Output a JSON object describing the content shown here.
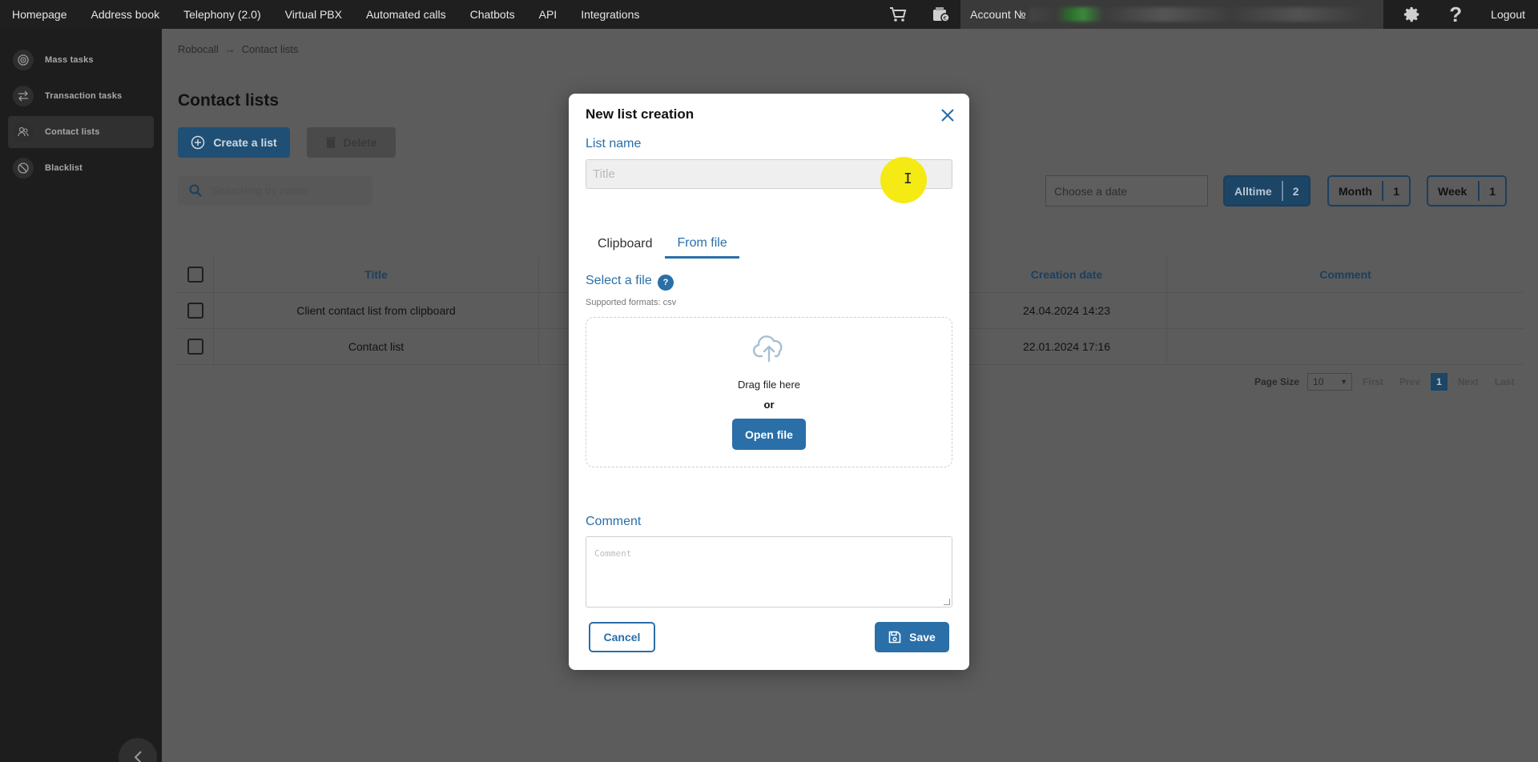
{
  "topnav": {
    "links": [
      "Homepage",
      "Address book",
      "Telephony (2.0)",
      "Virtual PBX",
      "Automated calls",
      "Chatbots",
      "API",
      "Integrations"
    ],
    "account_label": "Account №",
    "logout": "Logout",
    "icons": [
      "cart-icon",
      "wallet-icon",
      "gear-icon",
      "help-icon"
    ]
  },
  "sidebar": {
    "items": [
      {
        "label": "Mass tasks",
        "icon": "target-icon"
      },
      {
        "label": "Transaction tasks",
        "icon": "arrows-icon"
      },
      {
        "label": "Contact lists",
        "icon": "people-icon"
      },
      {
        "label": "Blacklist",
        "icon": "block-icon"
      }
    ],
    "active_index": 2
  },
  "breadcrumb": {
    "root": "Robocall",
    "current": "Contact lists"
  },
  "page": {
    "title": "Contact lists",
    "create_label": "Create a list",
    "delete_label": "Delete",
    "search_placeholder": "Searching by name",
    "date_placeholder": "Choose a date",
    "periods": [
      {
        "label": "Alltime",
        "count": "2"
      },
      {
        "label": "Month",
        "count": "1"
      },
      {
        "label": "Week",
        "count": "1"
      }
    ]
  },
  "table": {
    "headers": {
      "title": "Title",
      "creation_date": "Creation date",
      "comment": "Comment"
    },
    "rows": [
      {
        "title": "Client contact list from clipboard",
        "date": "24.04.2024 14:23",
        "comment": ""
      },
      {
        "title": "Contact list",
        "date": "22.01.2024 17:16",
        "comment": ""
      }
    ]
  },
  "pager": {
    "page_size_label": "Page Size",
    "page_size": "10",
    "first": "First",
    "prev": "Prev",
    "current": "1",
    "next": "Next",
    "last": "Last"
  },
  "modal": {
    "title": "New list creation",
    "list_name_label": "List name",
    "list_name_placeholder": "Title",
    "list_name_value": "",
    "tabs": [
      "Clipboard",
      "From file"
    ],
    "active_tab": 1,
    "select_file_label": "Select a file",
    "help_glyph": "?",
    "formats": "Supported formats: csv",
    "drag_text": "Drag file here",
    "or_text": "or",
    "open_file": "Open file",
    "comment_label": "Comment",
    "comment_placeholder": "Comment",
    "cancel": "Cancel",
    "save": "Save"
  },
  "colors": {
    "accent": "#2a6fa8",
    "cursor_highlight": "#f5ea14"
  }
}
